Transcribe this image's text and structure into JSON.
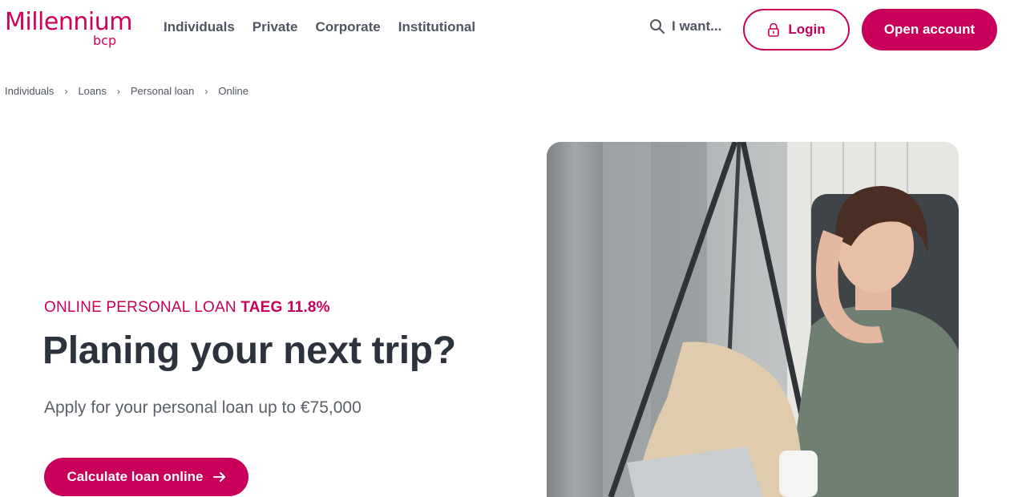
{
  "brand": {
    "name": "Millennium",
    "sub": "bcp",
    "color": "#d1005d"
  },
  "nav": {
    "items": [
      {
        "label": "Individuals"
      },
      {
        "label": "Private"
      },
      {
        "label": "Corporate"
      },
      {
        "label": "Institutional"
      }
    ],
    "search_label": "I want...",
    "search_icon": "search-icon",
    "login_label": "Login",
    "login_icon": "lock-icon",
    "open_account_label": "Open account"
  },
  "breadcrumb": {
    "items": [
      "Individuals",
      "Loans",
      "Personal loan",
      "Online"
    ],
    "separator": "›"
  },
  "hero": {
    "eyebrow_text": "ONLINE PERSONAL LOAN",
    "eyebrow_highlight": "TAEG 11.8%",
    "title": "Planing your next trip?",
    "subtitle": "Apply for your personal loan up to €75,000",
    "cta_label": "Calculate loan online",
    "cta_icon": "arrow-right-icon"
  },
  "colors": {
    "accent": "#c8005a",
    "text_dark": "#2d333d",
    "text_muted": "#4f5661"
  }
}
